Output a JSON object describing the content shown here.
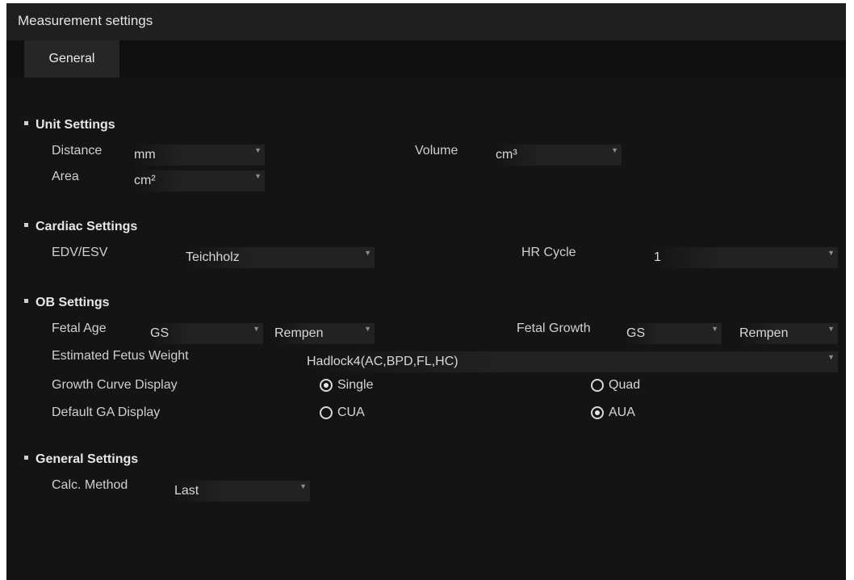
{
  "window": {
    "title": "Measurement settings"
  },
  "tabs": [
    {
      "label": "General",
      "active": true
    }
  ],
  "unit_settings": {
    "title": "Unit Settings",
    "distance": {
      "label": "Distance",
      "value": "mm"
    },
    "area": {
      "label": "Area",
      "value": "cm²"
    },
    "volume": {
      "label": "Volume",
      "value": "cm³"
    }
  },
  "cardiac_settings": {
    "title": "Cardiac Settings",
    "edv_esv": {
      "label": "EDV/ESV",
      "value": "Teichholz"
    },
    "hr_cycle": {
      "label": "HR Cycle",
      "value": "1"
    }
  },
  "ob_settings": {
    "title": "OB Settings",
    "fetal_age": {
      "label": "Fetal Age",
      "item": "GS",
      "method": "Rempen"
    },
    "fetal_growth": {
      "label": "Fetal Growth",
      "item": "GS",
      "method": "Rempen"
    },
    "estimated_fetus_weight": {
      "label": "Estimated Fetus Weight",
      "value": "Hadlock4(AC,BPD,FL,HC)"
    },
    "growth_curve_display": {
      "label": "Growth Curve Display",
      "options": [
        {
          "label": "Single",
          "selected": true
        },
        {
          "label": "Quad",
          "selected": false
        }
      ]
    },
    "default_ga_display": {
      "label": "Default GA Display",
      "options": [
        {
          "label": "CUA",
          "selected": false
        },
        {
          "label": "AUA",
          "selected": true
        }
      ]
    }
  },
  "general_settings": {
    "title": "General Settings",
    "calc_method": {
      "label": "Calc. Method",
      "value": "Last"
    }
  },
  "icons": {
    "dropdown": "chevron-down-icon",
    "radio_selected": "radio-selected-icon",
    "radio_unselected": "radio-unselected-icon"
  },
  "colors": {
    "background": "#141414",
    "titlebar": "#1f1f1f",
    "tab_active": "#262626",
    "text": "#d7d7d7"
  }
}
